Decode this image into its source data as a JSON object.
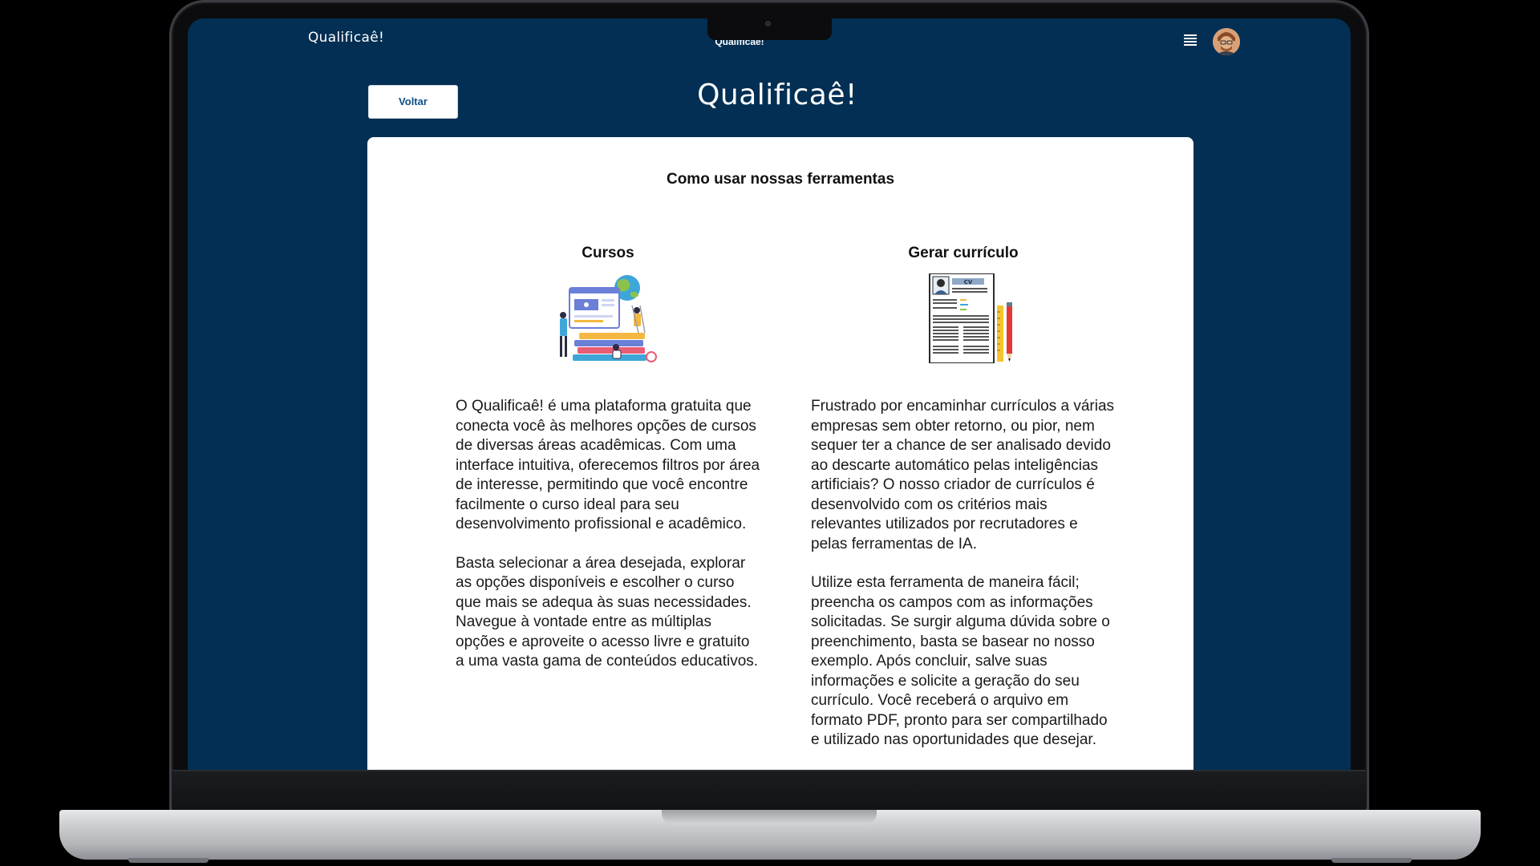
{
  "topbar": {
    "logo": "Qualificaê!",
    "title": "Qualificae!"
  },
  "header": {
    "back_label": "Voltar",
    "logo": "Qualificaê!"
  },
  "content": {
    "title": "Como usar nossas ferramentas",
    "cursos": {
      "heading": "Cursos",
      "paragraphs": [
        "O Qualificaê! é uma plataforma gratuita que conecta você às melhores opções de cursos de diversas áreas acadêmicas. Com uma interface intuitiva, oferecemos filtros por área de interesse, permitindo que você encontre facilmente o curso ideal para seu desenvolvimento profissional e acadêmico.",
        "Basta selecionar a área desejada, explorar as opções disponíveis e escolher o curso que mais se adequa às suas necessidades. Navegue à vontade entre as múltiplas opções e aproveite o acesso livre e gratuito a uma vasta gama de conteúdos educativos."
      ]
    },
    "curriculo": {
      "heading": "Gerar currículo",
      "badge": "CV",
      "paragraphs": [
        "Frustrado por encaminhar currículos a várias empresas sem obter retorno, ou pior, nem sequer ter a chance de ser analisado devido ao descarte automático pelas inteligências artificiais? O nosso criador de currículos é desenvolvido com os critérios mais relevantes utilizados por recrutadores e pelas ferramentas de IA.",
        "Utilize esta ferramenta de maneira fácil; preencha os campos com as informações solicitadas. Se surgir alguma dúvida sobre o preenchimento, basta se basear no nosso exemplo. Após concluir, salve suas informações e solicite a geração do seu currículo. Você receberá o arquivo em formato PDF, pronto para ser compartilhado e utilizado nas oportunidades que desejar."
      ]
    }
  },
  "icons": {
    "menu": "hamburger-menu-icon",
    "avatar": "user-avatar",
    "courses_illustration": "online-courses-illustration",
    "resume_illustration": "resume-document-illustration"
  },
  "colors": {
    "background": "#022f53",
    "card": "#ffffff",
    "button_text": "#0e4e86"
  }
}
